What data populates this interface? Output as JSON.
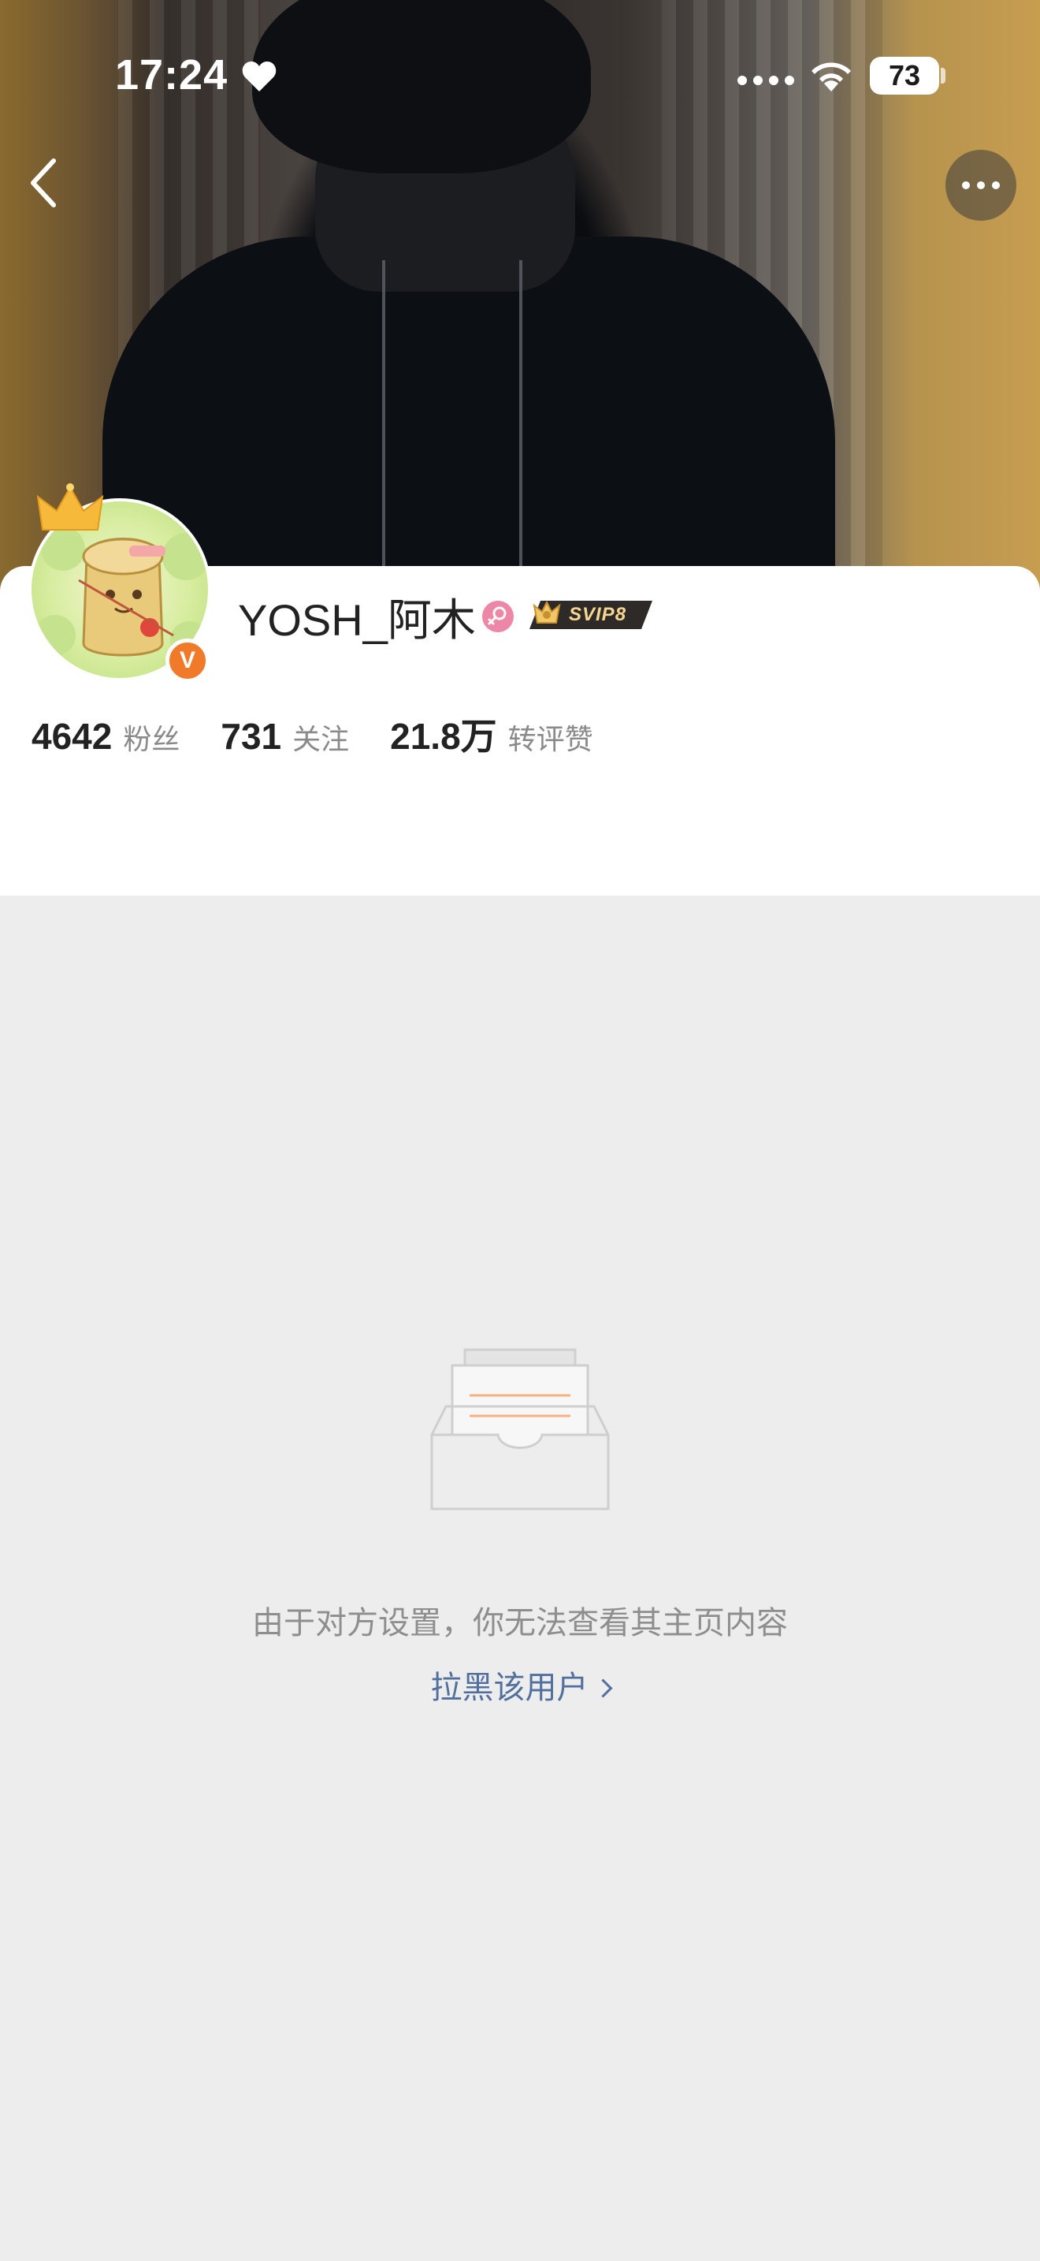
{
  "status_bar": {
    "time": "17:24",
    "battery": "73"
  },
  "profile": {
    "username": "YOSH_阿木",
    "badge": "SVIP8",
    "verified_mark": "V",
    "stats": [
      {
        "value": "4642",
        "label": "粉丝"
      },
      {
        "value": "731",
        "label": "关注"
      },
      {
        "value": "21.8万",
        "label": "转评赞"
      }
    ]
  },
  "empty_state": {
    "message": "由于对方设置，你无法查看其主页内容",
    "action": "拉黑该用户"
  },
  "icons": {
    "back": "chevron-left-icon",
    "more": "more-dots-icon",
    "gender": "female-icon",
    "empty": "empty-inbox-icon"
  },
  "colors": {
    "link": "#52709e",
    "verified": "#f07a2a",
    "gender": "#ec87a7",
    "background": "#ededed"
  }
}
